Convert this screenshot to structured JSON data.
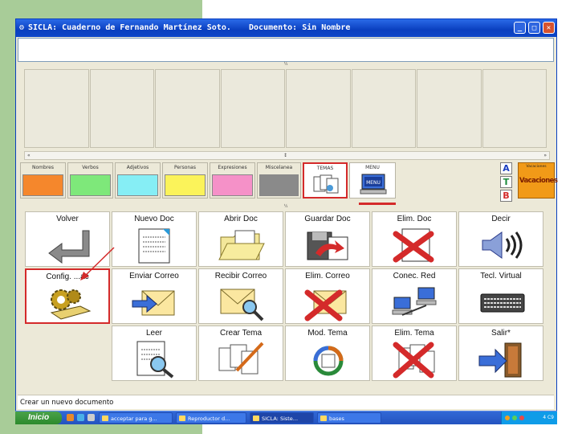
{
  "window": {
    "title": "SICLA: Cuaderno de Fernando Martínez Soto.",
    "document_label": "Documento: Sin Nombre",
    "minimize_glyph": "_",
    "maximize_glyph": "□",
    "close_glyph": "✕"
  },
  "document": {
    "text": ""
  },
  "dividers": {
    "top_marker": "¼",
    "middle_marker": "¼"
  },
  "scrollbar": {
    "left_glyph": "«",
    "center_glyph": "↕",
    "right_glyph": "»"
  },
  "categories": [
    {
      "label": "Nombres",
      "color": "#f5872c"
    },
    {
      "label": "Verbos",
      "color": "#7ee87a"
    },
    {
      "label": "Adjetivos",
      "color": "#86eef5"
    },
    {
      "label": "Personas",
      "color": "#fbf35a"
    },
    {
      "label": "Expresiones",
      "color": "#f591c8"
    },
    {
      "label": "Miscelanea",
      "color": "#8a8a8a"
    },
    {
      "label": "TEMAS",
      "icon": "documents-icon"
    },
    {
      "label": "MENU",
      "icon": "computer-menu-icon"
    }
  ],
  "atb": [
    "A",
    "T",
    "B"
  ],
  "vacaciones": {
    "small": "Vacaciones",
    "big": "Vacaciones"
  },
  "actions": [
    {
      "label": "Volver",
      "icon": "return-arrow-icon"
    },
    {
      "label": "Nuevo Doc",
      "icon": "new-document-icon"
    },
    {
      "label": "Abrir Doc",
      "icon": "open-folder-icon"
    },
    {
      "label": "Guardar Doc",
      "icon": "save-disk-icon"
    },
    {
      "label": "Elim. Doc",
      "icon": "delete-document-icon"
    },
    {
      "label": "Decir",
      "icon": "speaker-icon"
    },
    {
      "label": "Config. ...ac",
      "icon": "gears-icon"
    },
    {
      "label": "Enviar Correo",
      "icon": "send-mail-icon"
    },
    {
      "label": "Recibir Correo",
      "icon": "receive-mail-icon"
    },
    {
      "label": "Elim. Correo",
      "icon": "delete-mail-icon"
    },
    {
      "label": "Conec. Red",
      "icon": "network-computers-icon"
    },
    {
      "label": "Tecl. Virtual",
      "icon": "keyboard-icon"
    },
    {
      "label": "Leer",
      "icon": "read-magnifier-icon"
    },
    {
      "label": "Crear Tema",
      "icon": "create-theme-icon"
    },
    {
      "label": "Mod. Tema",
      "icon": "modify-theme-icon"
    },
    {
      "label": "Elim. Tema",
      "icon": "delete-theme-icon"
    },
    {
      "label": "Salir*",
      "icon": "exit-door-icon"
    }
  ],
  "status": "Crear un nuevo documento",
  "taskbar": {
    "start": "Inicio",
    "tasks": [
      "acceptar para g...",
      "Reproductor d...",
      "SICLA: Siste...",
      "bases"
    ],
    "clock": "4 C9"
  },
  "colors": {
    "highlight": "#d42a2a",
    "title_blue": "#0a3fbf"
  }
}
